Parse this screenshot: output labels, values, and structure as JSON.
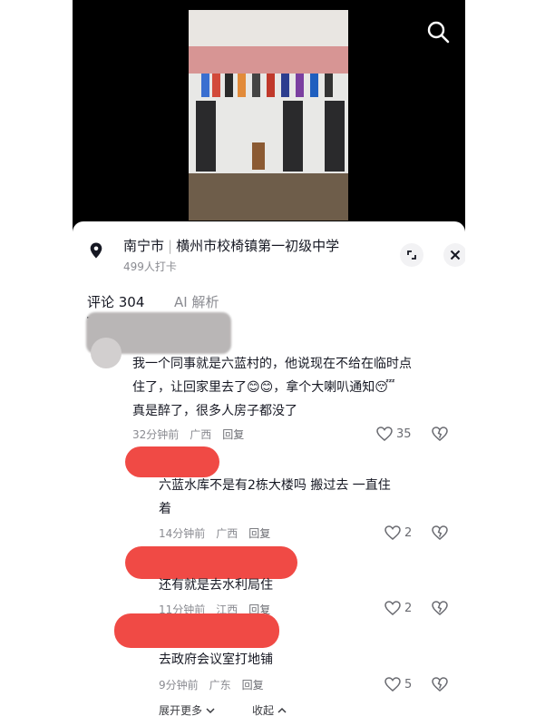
{
  "location": {
    "city": "南宁市",
    "place": "横州市校椅镇第一初级中学",
    "checkins": "499人打卡"
  },
  "tabs": {
    "comments": "评论 304",
    "ai": "AI 解析"
  },
  "comments": [
    {
      "text_lines": [
        "我一个同事就是六蓝村的，他说现在不给在临时点",
        "住了，让回家里去了😊😊，拿个大喇叭通知😴",
        "真是醉了，很多人房子都没了"
      ],
      "time": "32分钟前",
      "region": "广西",
      "reply": "回复",
      "likes": "35"
    },
    {
      "text_lines": [
        "六蓝水库不是有2栋大楼吗  搬过去   一直住",
        "着"
      ],
      "time": "14分钟前",
      "region": "广西",
      "reply": "回复",
      "likes": "2"
    },
    {
      "text_lines": [
        "还有就是去水利局住"
      ],
      "time": "11分钟前",
      "region": "江西",
      "reply": "回复",
      "likes": "2"
    },
    {
      "text_lines": [
        "去政府会议室打地铺"
      ],
      "time": "9分钟前",
      "region": "广东",
      "reply": "回复",
      "likes": "5"
    }
  ],
  "footer": {
    "expand_more": "展开更多",
    "collapse": "收起"
  },
  "colors": {
    "redaction": "#f04a45",
    "text": "#161823",
    "muted": "#8a8b91"
  }
}
